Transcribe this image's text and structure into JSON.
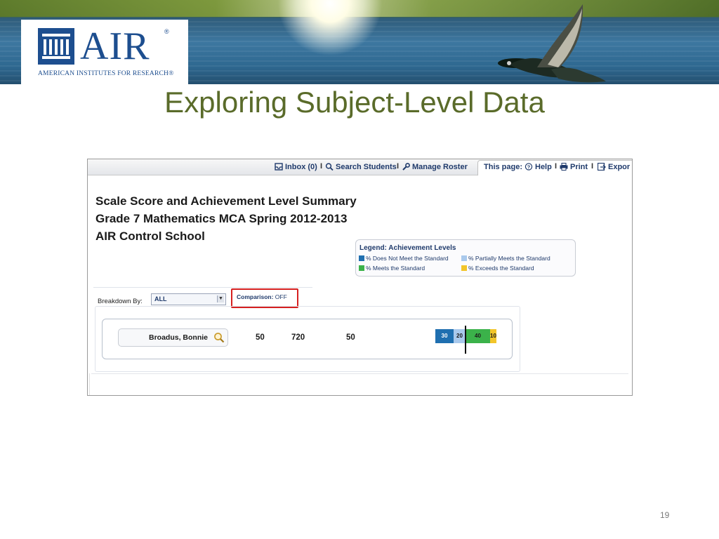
{
  "banner": {
    "logo": {
      "name": "AIR",
      "registered": "®",
      "subtitle": "AMERICAN INSTITUTES FOR RESEARCH®"
    }
  },
  "slide": {
    "title": "Exploring Subject-Level Data",
    "page_number": "19"
  },
  "app": {
    "toolbar": {
      "inbox": "Inbox (0)",
      "search_students": "Search Students",
      "manage_roster": "Manage Roster",
      "this_page": "This page:",
      "help": "Help",
      "print": "Print",
      "export": "Expor",
      "separator": "I"
    },
    "report": {
      "title": "Scale Score and Achievement Level Summary",
      "subtitle": "Grade 7 Mathematics MCA Spring 2012-2013",
      "school": "AIR Control School"
    },
    "legend": {
      "title": "Legend: Achievement Levels",
      "items": [
        {
          "label": "% Does Not Meet the Standard",
          "color": "#1f6fb0"
        },
        {
          "label": "% Partially Meets the Standard",
          "color": "#a9c9ec"
        },
        {
          "label": "% Meets the Standard",
          "color": "#3bb24a"
        },
        {
          "label": "% Exceeds the Standard",
          "color": "#f2c52a"
        }
      ]
    },
    "filters": {
      "breakdown_label": "Breakdown By:",
      "breakdown_value": "ALL",
      "comparison_label": "Comparison:",
      "comparison_value": "OFF"
    },
    "row": {
      "student": "Broadus, Bonnie",
      "value1": "50",
      "scale_score": "720",
      "value3": "50",
      "levels": [
        {
          "label": "30",
          "percent": 30,
          "color": "#1f6fb0",
          "text_color": "#ffffff"
        },
        {
          "label": "20",
          "percent": 20,
          "color": "#a9c9ec",
          "text_color": "#1a1a1a"
        },
        {
          "label": "40",
          "percent": 40,
          "color": "#3bb24a",
          "text_color": "#1a1a1a"
        },
        {
          "label": "10",
          "percent": 10,
          "color": "#f2c52a",
          "text_color": "#1a1a1a"
        }
      ]
    }
  }
}
